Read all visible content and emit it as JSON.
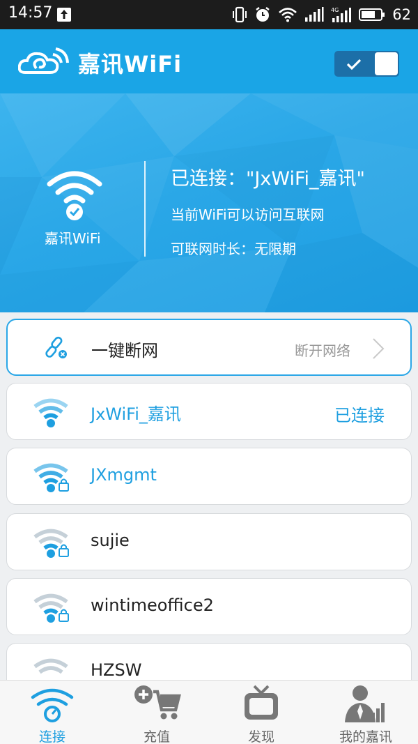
{
  "status_bar": {
    "time": "14:57",
    "battery": "62",
    "network_type": "4G"
  },
  "header": {
    "title": "嘉讯WiFi",
    "toggle_on": true
  },
  "hero": {
    "wifi_caption": "嘉讯WiFi",
    "connected_text": "已连接：\"JxWiFi_嘉讯\"",
    "internet_text": "当前WiFi可以访问互联网",
    "duration_text": "可联网时长：无限期"
  },
  "disconnect": {
    "label": "一键断网",
    "action_text": "断开网络"
  },
  "networks": [
    {
      "name": "JxWiFi_嘉讯",
      "status": "已连接",
      "locked": false,
      "signal_color": "#1e9fe0"
    },
    {
      "name": "JXmgmt",
      "status": "",
      "locked": true,
      "signal_color": "#1e9fe0"
    },
    {
      "name": "sujie",
      "status": "",
      "locked": true,
      "signal_color": "#8fa4b2"
    },
    {
      "name": "wintimeoffice2",
      "status": "",
      "locked": true,
      "signal_color": "#8fa4b2"
    },
    {
      "name": "HZSW",
      "status": "",
      "locked": true,
      "signal_color": "#8fa4b2"
    }
  ],
  "bottom_nav": [
    {
      "label": "连接",
      "icon": "wifi-connect-icon",
      "active": true
    },
    {
      "label": "充值",
      "icon": "cart-add-icon",
      "active": false
    },
    {
      "label": "发现",
      "icon": "tv-icon",
      "active": false
    },
    {
      "label": "我的嘉讯",
      "icon": "user-chart-icon",
      "active": false
    }
  ],
  "colors": {
    "brand": "#1aa5e6",
    "accent": "#1e9fe0",
    "status_bar": "#1c1c1c"
  }
}
